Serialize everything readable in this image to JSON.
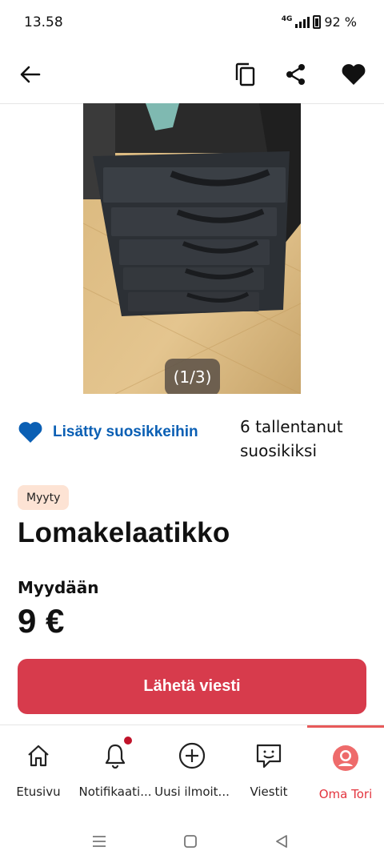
{
  "status": {
    "time": "13.58",
    "network": "4G",
    "battery": "92 %"
  },
  "topbar": {
    "back_icon": "arrow-left-icon",
    "copy_icon": "copy-icon",
    "share_icon": "share-icon",
    "favorite_icon": "heart-icon"
  },
  "gallery": {
    "counter": "(1/3)"
  },
  "favorite": {
    "label": "Lisätty suosikkeihin",
    "saved_count": "6 tallentanut suosikiksi"
  },
  "listing": {
    "badge": "Myyty",
    "title": "Lomakelaatikko",
    "sale_type": "Myydään",
    "price": "9 €"
  },
  "cta": {
    "label": "Lähetä viesti"
  },
  "nav": {
    "items": [
      {
        "label": "Etusivu",
        "icon": "home-icon"
      },
      {
        "label": "Notifikaati...",
        "icon": "bell-icon"
      },
      {
        "label": "Uusi ilmoit...",
        "icon": "plus-circle-icon"
      },
      {
        "label": "Viestit",
        "icon": "chat-icon"
      },
      {
        "label": "Oma Tori",
        "icon": "profile-icon"
      }
    ],
    "active_color": "#e3353f"
  },
  "colors": {
    "accent": "#d73b4c",
    "link": "#0a5fb4",
    "badge_bg": "#fde3d4"
  }
}
